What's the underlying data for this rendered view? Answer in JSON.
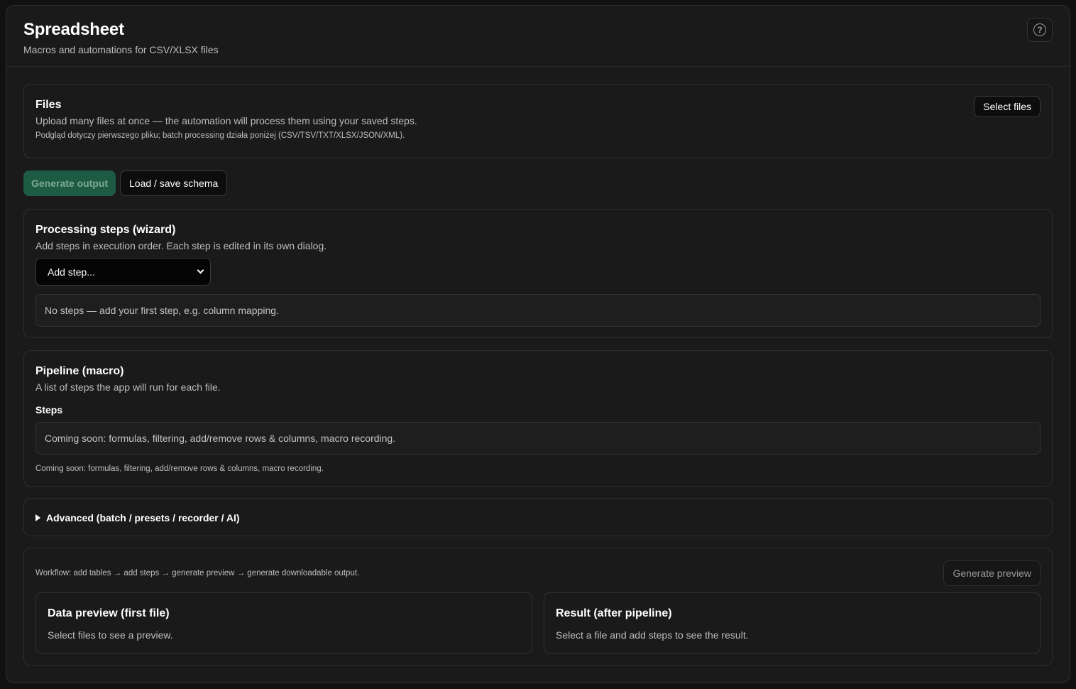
{
  "header": {
    "title": "Spreadsheet",
    "subtitle": "Macros and automations for CSV/XLSX files",
    "help_icon_glyph": "?"
  },
  "files": {
    "title": "Files",
    "description": "Upload many files at once — the automation will process them using your saved steps.",
    "note": "Podgląd dotyczy pierwszego pliku; batch processing działa poniżej (CSV/TSV/TXT/XLSX/JSON/XML).",
    "select_button": "Select files"
  },
  "actions": {
    "generate_output": "Generate output",
    "load_save_schema": "Load / save schema"
  },
  "wizard": {
    "title": "Processing steps (wizard)",
    "description": "Add steps in execution order. Each step is edited in its own dialog.",
    "add_step_select": "Add step...",
    "empty_message": "No steps — add your first step, e.g. column mapping."
  },
  "pipeline": {
    "title": "Pipeline (macro)",
    "description": "A list of steps the app will run for each file.",
    "steps_label": "Steps",
    "steps_box": "Coming soon: formulas, filtering, add/remove rows & columns, macro recording.",
    "note": "Coming soon: formulas, filtering, add/remove rows & columns, macro recording."
  },
  "advanced": {
    "label": "Advanced (batch / presets / recorder / AI)",
    "expanded": false
  },
  "workflow": {
    "text": "Workflow: add tables → add steps → generate preview → generate downloadable output.",
    "preview_button": "Generate preview",
    "data_preview": {
      "title": "Data preview (first file)",
      "message": "Select files to see a preview."
    },
    "result": {
      "title": "Result (after pipeline)",
      "message": "Select a file and add steps to see the result."
    }
  },
  "colors": {
    "background": "#1a1a1a",
    "border": "#2e2e2e",
    "accent_green": "#1d5b45"
  }
}
